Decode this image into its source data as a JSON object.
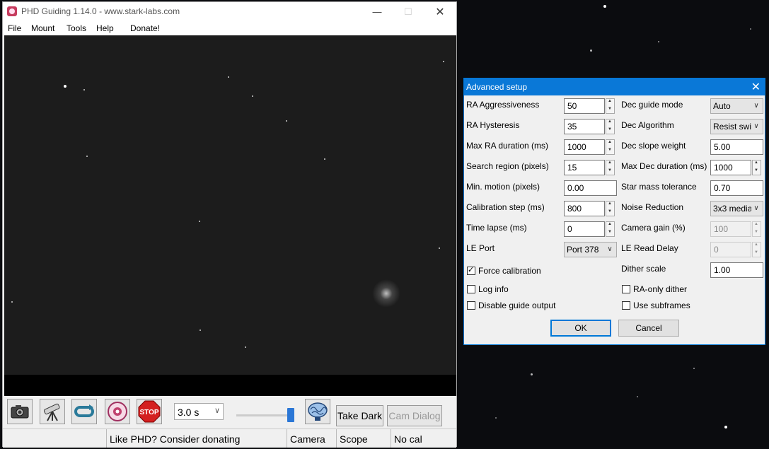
{
  "window": {
    "title": "PHD Guiding 1.14.0  -  www.stark-labs.com",
    "minimize_icon": "minimize-icon",
    "maximize_icon": "maximize-icon",
    "close_icon": "close-icon"
  },
  "menu": {
    "file": "File",
    "mount": "Mount",
    "tools": "Tools",
    "help": "Help",
    "donate": "Donate!"
  },
  "toolbar": {
    "exposure": "3.0 s",
    "take_dark": "Take Dark",
    "cam_dialog": "Cam Dialog",
    "icons": [
      "camera-icon",
      "telescope-icon",
      "loop-icon",
      "phd-guide-icon",
      "stop-icon",
      "brain-icon"
    ],
    "slider_level": 0.9
  },
  "status": {
    "message": "Like PHD? Consider donating",
    "camera": "Camera",
    "scope": "Scope",
    "calibration": "No cal"
  },
  "dialog": {
    "title": "Advanced setup",
    "left": {
      "ra_aggressiveness": {
        "label": "RA Aggressiveness",
        "value": "50"
      },
      "ra_hysteresis": {
        "label": "RA Hysteresis",
        "value": "35"
      },
      "max_ra_duration": {
        "label": "Max RA duration (ms)",
        "value": "1000"
      },
      "search_region": {
        "label": "Search region (pixels)",
        "value": "15"
      },
      "min_motion": {
        "label": "Min. motion (pixels)",
        "value": "0.00"
      },
      "calibration_step": {
        "label": "Calibration step (ms)",
        "value": "800"
      },
      "time_lapse": {
        "label": "Time lapse (ms)",
        "value": "0"
      },
      "le_port": {
        "label": "LE Port",
        "value": "Port 378"
      }
    },
    "right": {
      "dec_guide_mode": {
        "label": "Dec guide mode",
        "value": "Auto"
      },
      "dec_algorithm": {
        "label": "Dec Algorithm",
        "value": "Resist swi"
      },
      "dec_slope_weight": {
        "label": "Dec slope weight",
        "value": "5.00"
      },
      "max_dec_duration": {
        "label": "Max Dec duration (ms)",
        "value": "1000"
      },
      "star_mass_tolerance": {
        "label": "Star mass tolerance",
        "value": "0.70"
      },
      "noise_reduction": {
        "label": "Noise Reduction",
        "value": "3x3 media"
      },
      "camera_gain": {
        "label": "Camera gain (%)",
        "value": "100"
      },
      "le_read_delay": {
        "label": "LE Read Delay",
        "value": "0"
      },
      "dither_scale": {
        "label": "Dither scale",
        "value": "1.00"
      }
    },
    "checkboxes": {
      "force_calibration": {
        "label": "Force calibration",
        "checked": true
      },
      "log_info": {
        "label": "Log info",
        "checked": false
      },
      "disable_guide_output": {
        "label": "Disable guide output",
        "checked": false
      },
      "ra_only_dither": {
        "label": "RA-only dither",
        "checked": false
      },
      "use_subframes": {
        "label": "Use subframes",
        "checked": false
      }
    },
    "ok": "OK",
    "cancel": "Cancel"
  }
}
